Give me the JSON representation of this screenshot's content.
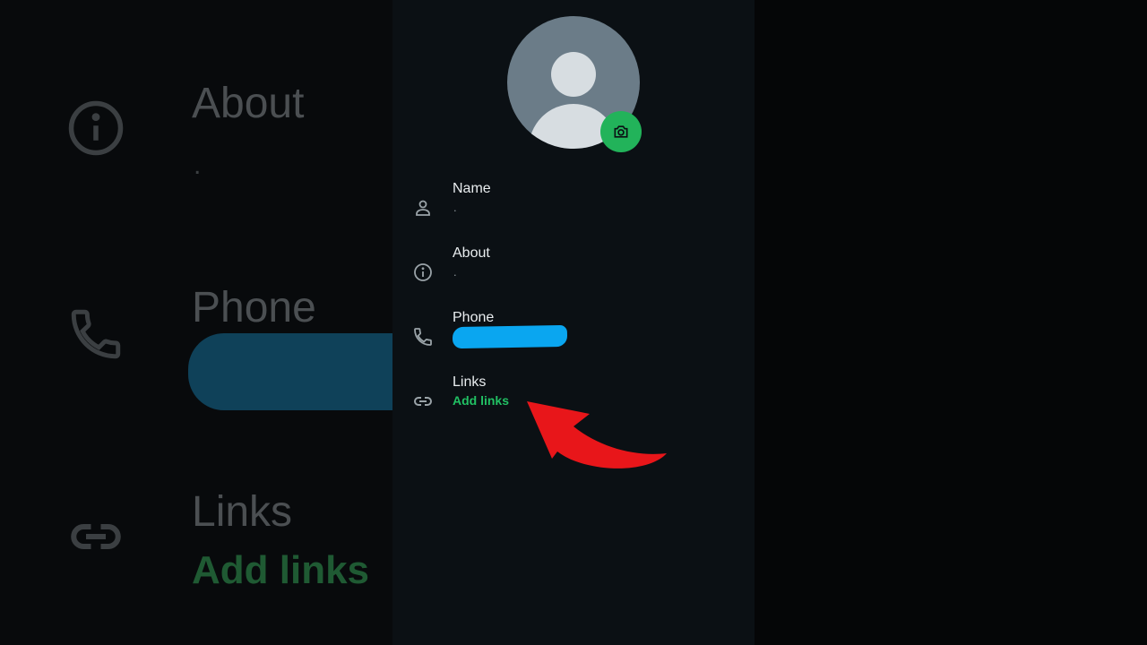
{
  "background": {
    "rows": [
      {
        "title": "About",
        "value": "."
      },
      {
        "title": "Phone"
      },
      {
        "title": "Links",
        "value": "Add links"
      }
    ]
  },
  "profile": {
    "rows": [
      {
        "icon": "person-icon",
        "label": "Name",
        "value": "."
      },
      {
        "icon": "info-icon",
        "label": "About",
        "value": "."
      },
      {
        "icon": "phone-icon",
        "label": "Phone",
        "value": ""
      },
      {
        "icon": "link-icon",
        "label": "Links",
        "value": "Add links"
      }
    ]
  },
  "colors": {
    "accent": "#21c063",
    "camera_button": "#22b35a",
    "redaction": "#0aa6f0",
    "annotation_arrow": "#e8161a"
  }
}
